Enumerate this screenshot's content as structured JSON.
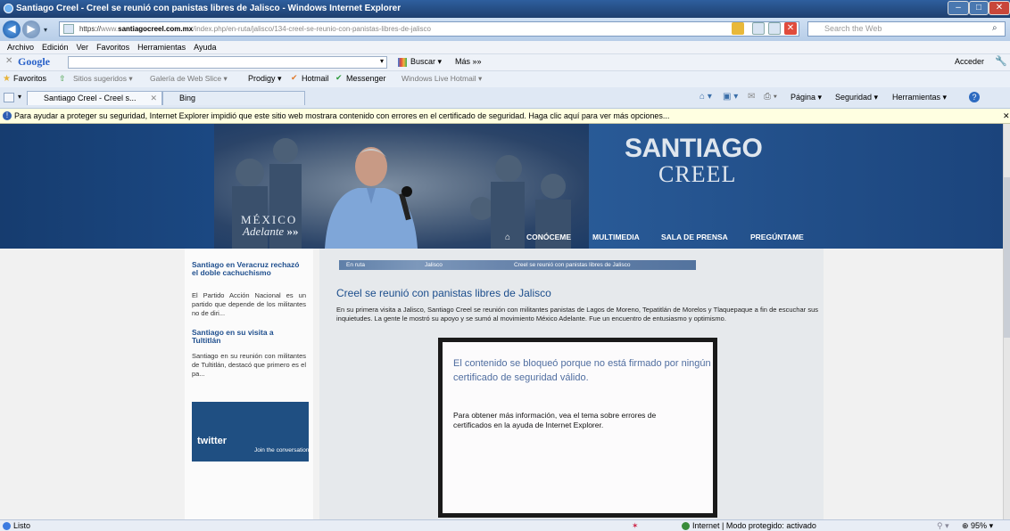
{
  "window": {
    "title": "Santiago Creel - Creel se reunió con panistas libres de Jalisco - Windows Internet Explorer"
  },
  "address_bar": {
    "url_prefix": "https://",
    "url_faded_pre": "www.",
    "url_domain": "santiagocreel.com.mx",
    "url_path": "/index.php/en-ruta/jalisco/134-creel-se-reunio-con-panistas-libres-de-jalisco",
    "search_placeholder": "Search the Web"
  },
  "menubar": {
    "items": [
      "Archivo",
      "Edición",
      "Ver",
      "Favoritos",
      "Herramientas",
      "Ayuda"
    ]
  },
  "google_toolbar": {
    "logo": "Google",
    "search_button": "Buscar",
    "more_link": "Más »»",
    "signin": "Acceder"
  },
  "favorites_bar": {
    "favorites_label": "Favoritos",
    "items": [
      "Sitios sugeridos ▾",
      "Galería de Web Slice ▾",
      "Prodigy ▾",
      "Hotmail",
      "Messenger",
      "Windows Live Hotmail ▾"
    ]
  },
  "tabs": {
    "active": "Santiago Creel - Creel s...",
    "other": "Bing",
    "commands": [
      "Página ▾",
      "Seguridad ▾",
      "Herramientas ▾"
    ]
  },
  "infobar": {
    "text": "Para ayudar a proteger su seguridad, Internet Explorer impidió que este sitio web mostrara contenido con errores en el certificado de seguridad. Haga clic aquí para ver más opciones..."
  },
  "site": {
    "brand_line1": "SANTIAGO",
    "brand_line2": "CREEL",
    "slogan_line1": "MÉXICO",
    "slogan_line2": "Adelante",
    "nav": [
      "CONÓCEME",
      "MULTIMEDIA",
      "SALA DE PRENSA",
      "PREGÚNTAME"
    ],
    "sidebar": {
      "item1_title": "Santiago en Veracruz rechazó el doble cachuchismo",
      "item1_text": "El Partido Acción Nacional es un partido que depende de los militantes no de diri...",
      "item2_title": "Santiago en su visita a Tultitlán",
      "item2_text": "Santiago en su reunión con militantes de Tultitlán, destacó que primero es el pa...",
      "twitter_logo": "twitter",
      "twitter_sub": "Join the conversation"
    },
    "breadcrumb": [
      "En ruta",
      "Jalisco",
      "Creel se reunió con panistas libres de Jalisco"
    ],
    "article_title": "Creel se reunió con panistas libres de Jalisco",
    "article_body": "En su primera visita a Jalisco, Santiago Creel se reunión con militantes panistas de Lagos de Moreno, Tepatitlán de Morelos y Tlaquepaque a fin de escuchar sus inquietudes. La gente le mostró su apoyo y se sumó al movimiento México Adelante. Fue un encuentro de entusiasmo y optimismo.",
    "blocked_heading": "El contenido se bloqueó porque no está firmado por ningún certificado de seguridad válido.",
    "blocked_text": "Para obtener más información, vea el tema sobre errores de certificados en la ayuda de Internet Explorer."
  },
  "statusbar": {
    "left": "Listo",
    "zone": "Internet | Modo protegido: activado",
    "zoom": "95%"
  },
  "colors": {
    "header_blue": "#1d4d8a",
    "link_blue": "#1f4f8e",
    "infobar_yellow": "#ffffe1"
  }
}
